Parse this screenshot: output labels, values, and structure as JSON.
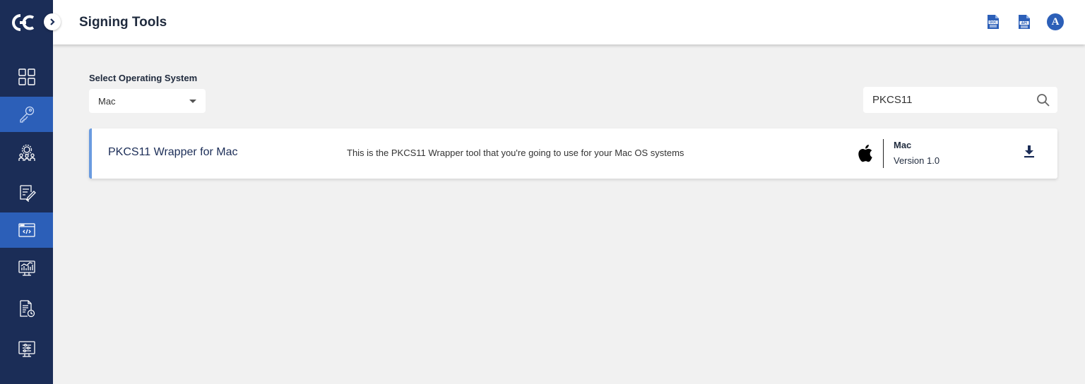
{
  "header": {
    "title": "Signing Tools",
    "icons": [
      "doc-icon",
      "api-icon"
    ],
    "avatar_initial": "A",
    "doc_icon_text": "DOC",
    "api_icon_text": "API"
  },
  "sidebar": {
    "items": [
      {
        "icon": "dashboard-icon",
        "active": false
      },
      {
        "icon": "key-icon",
        "active": true
      },
      {
        "icon": "team-gear-icon",
        "active": false
      },
      {
        "icon": "edit-document-icon",
        "active": false
      },
      {
        "icon": "code-window-icon",
        "active": true
      },
      {
        "icon": "analytics-monitor-icon",
        "active": false
      },
      {
        "icon": "document-clock-icon",
        "active": false
      },
      {
        "icon": "settings-monitor-icon",
        "active": false
      }
    ]
  },
  "filter": {
    "label": "Select Operating System",
    "selected": "Mac"
  },
  "search": {
    "value": "PKCS11"
  },
  "tools": [
    {
      "name": "PKCS11 Wrapper for Mac",
      "description": "This is the PKCS11 Wrapper tool that you're going to use for your Mac OS systems",
      "os": "Mac",
      "version": "Version 1.0",
      "os_icon": "apple-icon"
    }
  ],
  "colors": {
    "sidebar_bg": "#1b2d57",
    "active_bg": "#2c5fb8",
    "accent": "#6a9be0",
    "page_bg": "#f1f1f1"
  }
}
